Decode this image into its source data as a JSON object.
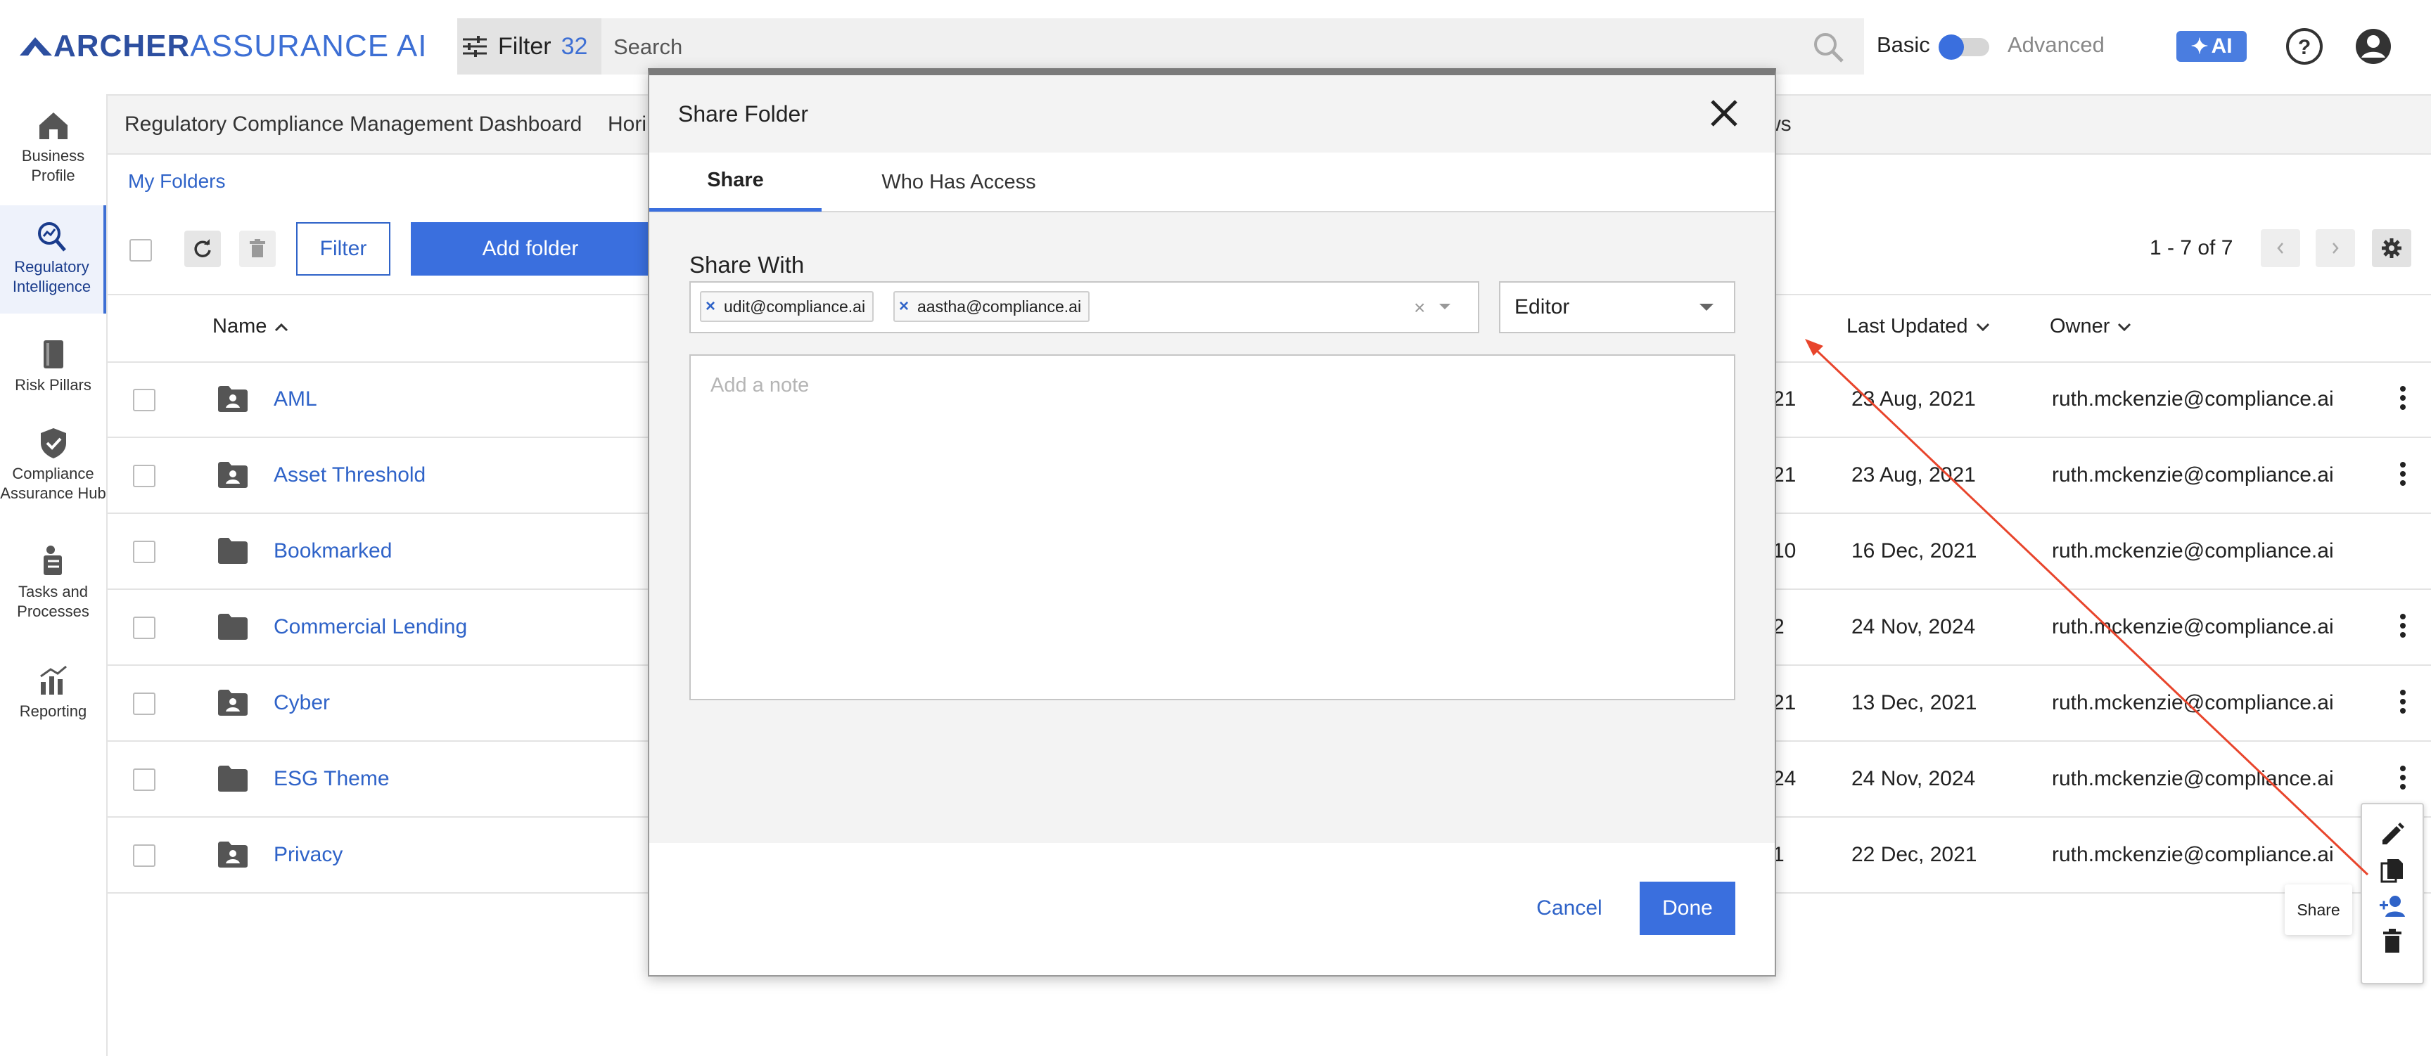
{
  "header": {
    "logo_part1": "ARCHER",
    "logo_part2": "ASSURANCE AI",
    "filter_label": "Filter",
    "filter_count": "32",
    "search_placeholder": "Search",
    "mode_basic": "Basic",
    "mode_advanced": "Advanced",
    "mode_toggle_on": true,
    "ai_button": "AI"
  },
  "sidebar": {
    "items": [
      {
        "label": "Business Profile",
        "icon": "home-icon"
      },
      {
        "label": "Regulatory Intelligence",
        "icon": "search-analytics-icon",
        "active": true
      },
      {
        "label": "Risk Pillars",
        "icon": "book-icon"
      },
      {
        "label": "Compliance Assurance Hub",
        "icon": "shield-check-icon"
      },
      {
        "label": "Tasks and Processes",
        "icon": "tasks-icon"
      },
      {
        "label": "Reporting",
        "icon": "bar-chart-icon"
      }
    ]
  },
  "main": {
    "tabs": [
      "Regulatory Compliance Management Dashboard",
      "Hori",
      "ws"
    ],
    "breadcrumb": "My Folders",
    "filter_button": "Filter",
    "add_folder_button": "Add folder",
    "pagination": "1 - 7 of 7",
    "columns": {
      "name": "Name",
      "last_updated": "Last Updated",
      "owner": "Owner"
    },
    "rows": [
      {
        "name": "AML",
        "shared": true,
        "col1": "21",
        "last_updated": "23 Aug, 2021",
        "owner": "ruth.mckenzie@compliance.ai",
        "menu": true
      },
      {
        "name": "Asset Threshold",
        "shared": true,
        "col1": "21",
        "last_updated": "23 Aug, 2021",
        "owner": "ruth.mckenzie@compliance.ai",
        "menu": true
      },
      {
        "name": "Bookmarked",
        "shared": false,
        "col1": "10",
        "last_updated": "16 Dec, 2021",
        "owner": "ruth.mckenzie@compliance.ai",
        "menu": false
      },
      {
        "name": "Commercial Lending",
        "shared": false,
        "col1": "2",
        "last_updated": "24 Nov, 2024",
        "owner": "ruth.mckenzie@compliance.ai",
        "menu": true
      },
      {
        "name": "Cyber",
        "shared": true,
        "col1": "21",
        "last_updated": "13 Dec, 2021",
        "owner": "ruth.mckenzie@compliance.ai",
        "menu": true
      },
      {
        "name": "ESG Theme",
        "shared": false,
        "col1": "24",
        "last_updated": "24 Nov, 2024",
        "owner": "ruth.mckenzie@compliance.ai",
        "menu": true
      },
      {
        "name": "Privacy",
        "shared": true,
        "col1": "1",
        "last_updated": "22 Dec, 2021",
        "owner": "ruth.mckenzie@compliance.ai",
        "menu": false
      }
    ]
  },
  "action_menu": {
    "items": [
      "edit-icon",
      "copy-icon",
      "share-person-add-icon",
      "delete-icon"
    ],
    "tooltip": "Share"
  },
  "modal": {
    "title": "Share Folder",
    "tab_share": "Share",
    "tab_access": "Who Has Access",
    "share_with_label": "Share With",
    "recipients": [
      "udit@compliance.ai",
      "aastha@compliance.ai"
    ],
    "role": "Editor",
    "note_placeholder": "Add a note",
    "cancel": "Cancel",
    "done": "Done"
  },
  "colors": {
    "accent": "#3a6fde",
    "link": "#2f63c8",
    "annotation_arrow": "#e8452c"
  }
}
